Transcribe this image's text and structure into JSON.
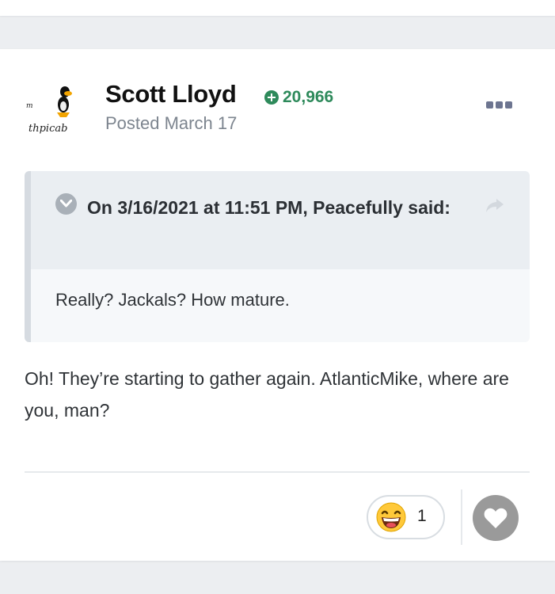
{
  "post": {
    "author": "Scott Lloyd",
    "reputation": "20,966",
    "posted": "Posted March 17",
    "avatar_text_top": "m",
    "avatar_text_bottom": "thpicab"
  },
  "quote": {
    "citation": "On 3/16/2021 at 11:51 PM, Peacefully said:",
    "body": "Really? Jackals? How mature."
  },
  "content": {
    "text": "Oh! They’re starting to gather again. AtlanticMike, where are you, man?"
  },
  "reactions": {
    "count": "1",
    "emoji": "laughing-face-icon"
  },
  "colors": {
    "reputation": "#2e8a5b",
    "like_button": "#9a9a9a"
  }
}
